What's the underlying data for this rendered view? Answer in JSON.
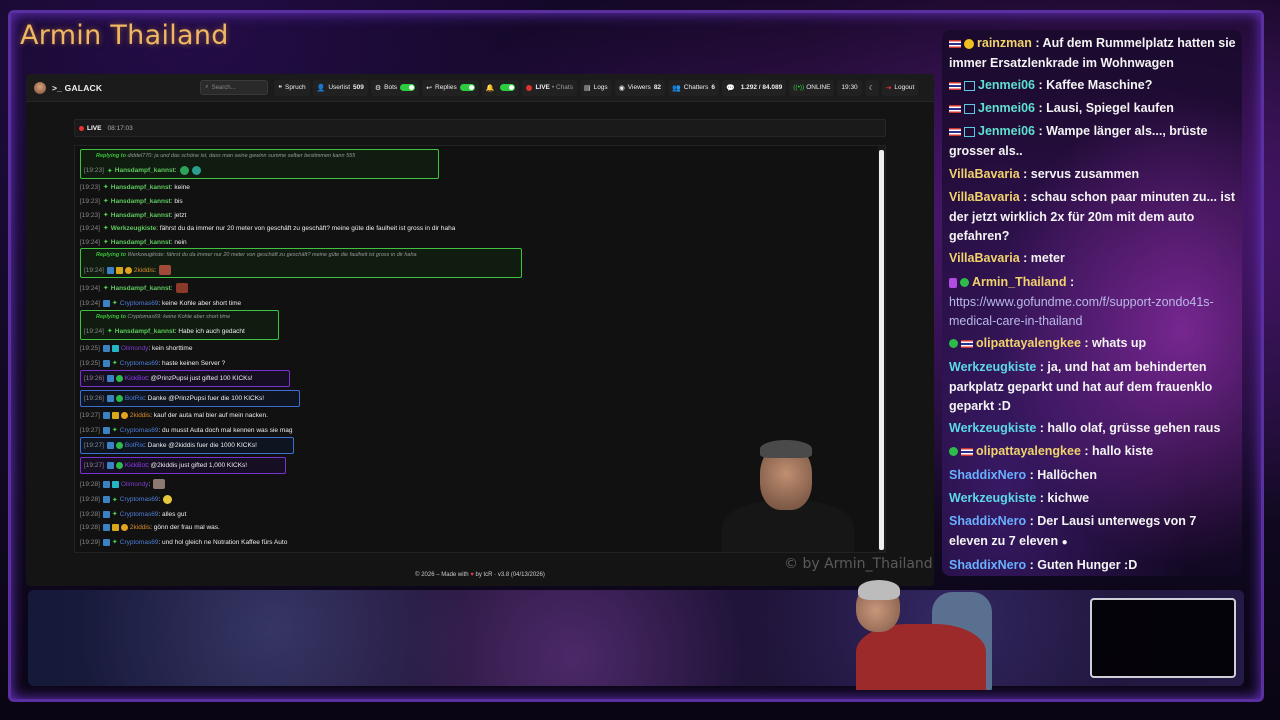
{
  "stream_title": "Armin Thailand",
  "navbar": {
    "brand": ">_ GALACK",
    "search_placeholder": "Search...",
    "spruch": "Spruch",
    "userlist": "Userlist",
    "userlist_count": "509",
    "bots": "Bots",
    "replies": "Replies",
    "live": "LIVE",
    "live_sub": "• Chats",
    "logs": "Logs",
    "viewers": "Viewers",
    "viewers_count": "82",
    "chatters": "Chatters",
    "chatters_count": "6",
    "messages": "1.292 / 84.089",
    "online": "ONLINE",
    "clock": "19:30",
    "logout": "Logout"
  },
  "live_bar": {
    "label": "LIVE",
    "time": "08:17:03"
  },
  "chat": {
    "r1_reply": "diddel770: ja und das schöne ist, dass man seine gewinn summe selber bestimmen kann 555",
    "r1_ts": "[19:23]",
    "r1_user": "Hansdampf_kannst",
    "m1_ts": "[19:23]",
    "m1_user": "Hansdampf_kannst",
    "m1_text": ": keine",
    "m2_ts": "[19:23]",
    "m2_user": "Hansdampf_kannst",
    "m2_text": ": bis",
    "m3_ts": "[19:23]",
    "m3_user": "Hansdampf_kannst",
    "m3_text": ": jetzt",
    "m4_ts": "[19:24]",
    "m4_user": "Werkzeugkiste",
    "m4_text": ": fährst du da immer nur 20 meter von geschäft zu geschäft? meine güte die faulheit ist gross in dir haha",
    "m5_ts": "[19:24]",
    "m5_user": "Hansdampf_kannst",
    "m5_text": ": nein",
    "r2_reply": "Werkzeugkiste: fährst du da immer nur 20 meter von geschäft zu geschäft? meine güte die faulheit ist gross in dir haha",
    "r2_ts": "[19:24]",
    "r2_user": "2kiddis",
    "m6_ts": "[19:24]",
    "m6_user": "Hansdampf_kannst",
    "m7_ts": "[19:24]",
    "m7_user": "Cryptomas69",
    "m7_text": ": keine Kohle aber short time",
    "r3_reply": "Cryptomas69: keine Kohle aber short time",
    "r3_ts": "[19:24]",
    "r3_user": "Hansdampf_kannst",
    "r3_text": ": Habe ich auch gedacht",
    "m8_ts": "[19:25]",
    "m8_user": "Olimondy",
    "m8_text": ": kein shorttime",
    "m9_ts": "[19:25]",
    "m9_user": "Cryptomas69",
    "m9_text": ": haste keinen Server ?",
    "k1_ts": "[19:26]",
    "k1_user": "KickBot",
    "k1_text": ": @PrinzPupsi just gifted 100 KICKs!",
    "b1_ts": "[19:26]",
    "b1_user": "BotRix",
    "b1_text": ": Danke @PrinzPupsi fuer die 100 KICKs!",
    "m10_ts": "[19:27]",
    "m10_user": "2kiddis",
    "m10_text": ": kauf der auta mal bier auf mein nacken.",
    "m11_ts": "[19:27]",
    "m11_user": "Cryptomas69",
    "m11_text": ": du musst Auta doch mal kennen was sie mag",
    "b2_ts": "[19:27]",
    "b2_user": "BotRix",
    "b2_text": ": Danke @2kiddis fuer die 1000 KICKs!",
    "k2_ts": "[19:27]",
    "k2_user": "KickBot",
    "k2_text": ": @2kiddis just gifted 1,000 KICKs!",
    "m12_ts": "[19:28]",
    "m12_user": "Olimondy",
    "m13_ts": "[19:28]",
    "m13_user": "Cryptomas69",
    "m14_ts": "[19:28]",
    "m14_user": "Cryptomas69",
    "m14_text": ": alles gut",
    "m15_ts": "[19:28]",
    "m15_user": "2kiddis",
    "m15_text": ": gönn der frau mal was.",
    "m16_ts": "[19:29]",
    "m16_user": "Cryptomas69",
    "m16_text": ": und hol gleich ne Notration Kaffee fürs Auto",
    "replying_to": "Replying to"
  },
  "footer": {
    "left": "© 2026 – Made with",
    "right": "by tcR · v3.8 (04/13/2026)"
  },
  "watermark": "© by Armin_Thailand",
  "overlay": [
    {
      "user": "rainzman",
      "text": ": Auf dem Rummelplatz hatten sie immer Ersatzlenkrade im Wohnwagen"
    },
    {
      "user": "Jenmei06",
      "text": ": Kaffee Maschine?"
    },
    {
      "user": "Jenmei06",
      "text": ": Lausi, Spiegel kaufen"
    },
    {
      "user": "Jenmei06",
      "text": ": Wampe länger als..., brüste grosser als.."
    },
    {
      "user": "VillaBavaria",
      "text": ": servus zusammen"
    },
    {
      "user": "VillaBavaria",
      "text": ": schau schon paar minuten zu... ist der jetzt wirklich 2x für 20m mit dem auto gefahren?"
    },
    {
      "user": "VillaBavaria",
      "text": ": meter"
    },
    {
      "user": "Armin_Thailand",
      "text": ":",
      "link": "https://www.gofundme.com/f/support-zondo41s-medical-care-in-thailand"
    },
    {
      "user": "olipattayalengkee",
      "text": ": whats up"
    },
    {
      "user": "Werkzeugkiste",
      "text": ": ja, und hat am behinderten parkplatz geparkt und hat auf dem frauenklo geparkt :D"
    },
    {
      "user": "Werkzeugkiste",
      "text": ": hallo olaf, grüsse gehen raus"
    },
    {
      "user": "olipattayalengkee",
      "text": ": hallo kiste"
    },
    {
      "user": "ShaddixNero",
      "text": ": Hallöchen"
    },
    {
      "user": "Werkzeugkiste",
      "text": ": kichwe"
    },
    {
      "user": "ShaddixNero",
      "text": ": Der Lausi unterwegs von 7 eleven zu 7 eleven"
    },
    {
      "user": "ShaddixNero",
      "text": ": Guten Hunger :D"
    }
  ]
}
